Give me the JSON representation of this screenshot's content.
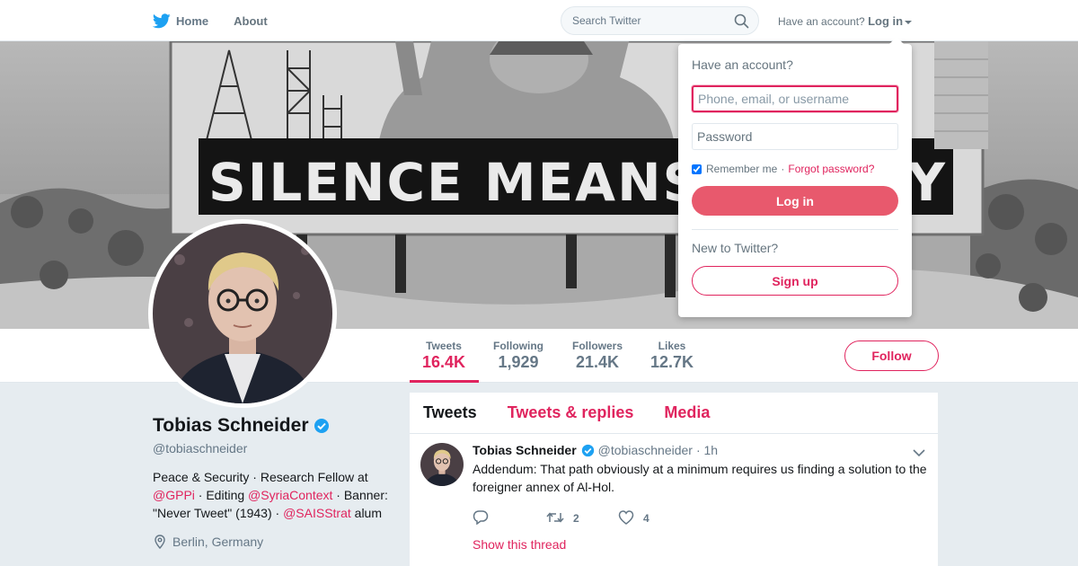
{
  "topnav": {
    "home_label": "Home",
    "about_label": "About",
    "search_placeholder": "Search Twitter",
    "have_account_text": "Have an account?",
    "login_label": "Log in"
  },
  "banner": {
    "billboard_text": "SILENCE MEANS S",
    "billboard_trailing_text": "Y"
  },
  "profile_nav": {
    "stats": [
      {
        "label": "Tweets",
        "value": "16.4K"
      },
      {
        "label": "Following",
        "value": "1,929"
      },
      {
        "label": "Followers",
        "value": "21.4K"
      },
      {
        "label": "Likes",
        "value": "12.7K"
      }
    ],
    "follow_label": "Follow"
  },
  "profile": {
    "name": "Tobias Schneider",
    "handle": "@tobiaschneider",
    "bio": {
      "part1": "Peace & Security · Research Fellow at ",
      "link1": "@GPPi",
      "part2": " · Editing ",
      "link2": "@SyriaContext",
      "part3": " · Banner: \"Never Tweet\" (1943) · ",
      "link3": "@SAISStrat",
      "part4": " alum"
    },
    "location": "Berlin, Germany"
  },
  "timeline": {
    "tabs": [
      "Tweets",
      "Tweets & replies",
      "Media"
    ],
    "tweet": {
      "author": "Tobias Schneider",
      "handle": "@tobiaschneider",
      "time": "· 1h",
      "text": "Addendum: That path obviously at a minimum requires us finding a solution to the foreigner annex of Al-Hol.",
      "reply_count": "",
      "retweet_count": "2",
      "like_count": "4",
      "show_thread": "Show this thread"
    }
  },
  "login_dropdown": {
    "title": "Have an account?",
    "username_placeholder": "Phone, email, or username",
    "password_placeholder": "Password",
    "remember_label": "Remember me",
    "separator": "·",
    "forgot_label": "Forgot password?",
    "login_button": "Log in",
    "new_text": "New to Twitter?",
    "signup_button": "Sign up"
  },
  "colors": {
    "accent": "#e0245e",
    "login_button": "#e8596d",
    "verified": "#1da1f2",
    "bird": "#1da1f2",
    "background": "#e6ecf0"
  },
  "icons": {
    "brand": "twitter-bird-icon",
    "search": "search-icon",
    "verified": "verified-badge-icon",
    "location": "location-pin-icon",
    "reply": "reply-icon",
    "retweet": "retweet-icon",
    "like": "heart-icon",
    "more": "chevron-down-icon"
  }
}
